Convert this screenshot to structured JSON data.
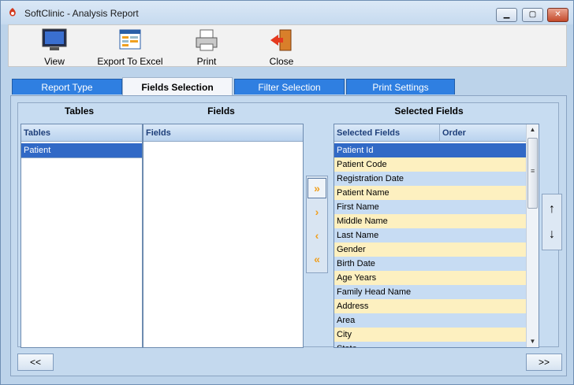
{
  "window": {
    "title": "SoftClinic - Analysis Report"
  },
  "toolbar": {
    "view": "View",
    "export": "Export To Excel",
    "print": "Print",
    "close": "Close"
  },
  "tabs": [
    "Report Type",
    "Fields Selection",
    "Filter Selection",
    "Print Settings"
  ],
  "groups": {
    "tables": "Tables",
    "fields": "Fields",
    "selected": "Selected Fields"
  },
  "tables_list": {
    "header": "Tables",
    "items": [
      "Patient"
    ]
  },
  "fields_list": {
    "header": "Fields",
    "items": []
  },
  "selected_list": {
    "header_fields": "Selected Fields",
    "header_order": "Order",
    "items": [
      "Patient Id",
      "Patient Code",
      "Registration Date",
      "Patient Name",
      "First Name",
      "Middle Name",
      "Last Name",
      "Gender",
      "Birth Date",
      "Age Years",
      "Family Head Name",
      "Address",
      "Area",
      "City",
      "State"
    ]
  },
  "move": {
    "add_all": "»",
    "add": "›",
    "remove": "‹",
    "remove_all": "«"
  },
  "order": {
    "up": "↑",
    "down": "↓"
  },
  "nav": {
    "prev": "<<",
    "next": ">>"
  }
}
